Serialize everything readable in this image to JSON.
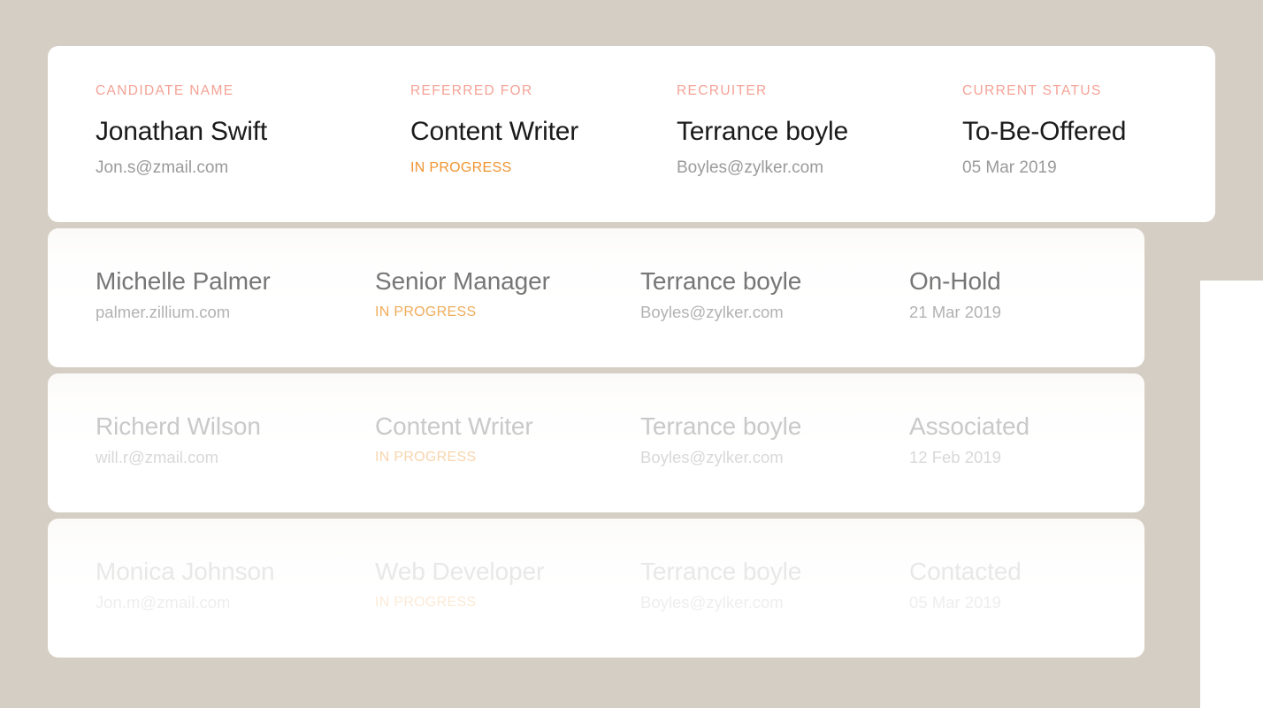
{
  "theme": {
    "background": "#d5cec4",
    "card_background": "#ffffff",
    "label_color": "#f4a296",
    "primary_text": "#1b1b1b",
    "secondary_text": "#9a9a9a",
    "status_progress_color": "#ef9430"
  },
  "columns": [
    {
      "key": "candidate_name",
      "label": "CANDIDATE NAME"
    },
    {
      "key": "referred_for",
      "label": "REFERRED FOR"
    },
    {
      "key": "recruiter",
      "label": "RECRUITER"
    },
    {
      "key": "current_status",
      "label": "CURRENT STATUS"
    }
  ],
  "featured": {
    "candidate_name": "Jonathan Swift",
    "candidate_email": "Jon.s@zmail.com",
    "referred_for": "Content Writer",
    "referral_status": "IN PROGRESS",
    "recruiter": "Terrance boyle",
    "recruiter_email": "Boyles@zylker.com",
    "current_status": "To-Be-Offered",
    "status_date": "05 Mar 2019"
  },
  "rows": [
    {
      "candidate_name": "Michelle Palmer",
      "candidate_email": "palmer.zillium.com",
      "referred_for": "Senior Manager",
      "referral_status": "IN PROGRESS",
      "recruiter": "Terrance boyle",
      "recruiter_email": "Boyles@zylker.com",
      "current_status": "On-Hold",
      "status_date": "21 Mar 2019"
    },
    {
      "candidate_name": "Richerd Wilson",
      "candidate_email": "will.r@zmail.com",
      "referred_for": "Content Writer",
      "referral_status": "IN PROGRESS",
      "recruiter": "Terrance boyle",
      "recruiter_email": "Boyles@zylker.com",
      "current_status": "Associated",
      "status_date": "12 Feb 2019"
    },
    {
      "candidate_name": "Monica Johnson",
      "candidate_email": "Jon.m@zmail.com",
      "referred_for": "Web Developer",
      "referral_status": "IN PROGRESS",
      "recruiter": "Terrance boyle",
      "recruiter_email": "Boyles@zylker.com",
      "current_status": "Contacted",
      "status_date": "05 Mar 2019"
    }
  ]
}
